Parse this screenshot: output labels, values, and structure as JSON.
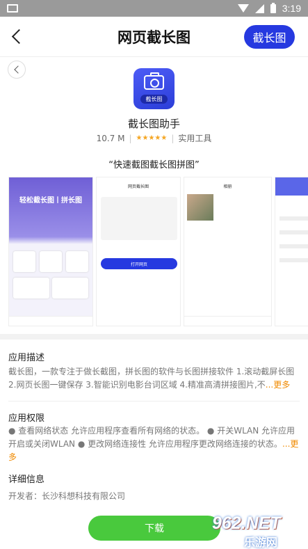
{
  "status_bar": {
    "time": "3:19"
  },
  "topbar": {
    "title": "网页截长图",
    "action_label": "截长图"
  },
  "app": {
    "icon_badge": "截长图",
    "name": "截长图助手",
    "size": "10.7 M",
    "stars": "★★★★★",
    "category": "实用工具",
    "tagline": "“快速截图截长图拼图”"
  },
  "screenshots": {
    "shot1_title": "轻松截长图丨拼长图",
    "shot2_header": "网页截长图",
    "shot2_button": "打开网页",
    "shot3_header": "相册"
  },
  "description": {
    "title": "应用描述",
    "text": "截长图，一款专注于做长截图，拼长图的软件与长图拼接软件 1.滚动截屏长图 2.网页长图一键保存 3.智能识别电影台词区域 4.精准高清拼接图片,不",
    "more": "...更多"
  },
  "permissions": {
    "title": "应用权限",
    "text": "● 查看网络状态 允许应用程序查看所有网络的状态。 ● 开关WLAN 允许应用开启或关闭WLAN ● 更改网络连接性 允许应用程序更改网络连接的状态。",
    "more": "...更多"
  },
  "details": {
    "title": "详细信息",
    "developer": "开发者：长沙科想科技有限公司"
  },
  "download": {
    "label": "下载"
  },
  "watermark": {
    "number": "962.NET",
    "cn": "乐游网"
  },
  "colors": {
    "accent": "#2639e0",
    "download": "#49c93d",
    "more": "#f08a00",
    "stars": "#f5a623"
  }
}
